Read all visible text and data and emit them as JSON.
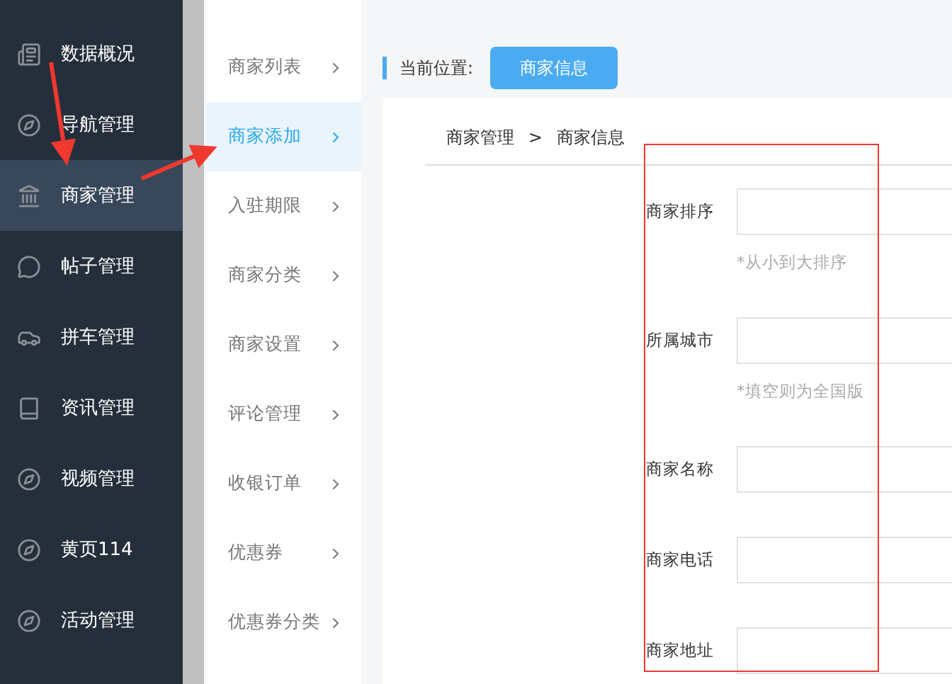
{
  "sidebar": {
    "items": [
      {
        "label": "数据概况",
        "selected": false
      },
      {
        "label": "导航管理",
        "selected": false
      },
      {
        "label": "商家管理",
        "selected": true
      },
      {
        "label": "帖子管理",
        "selected": false
      },
      {
        "label": "拼车管理",
        "selected": false
      },
      {
        "label": "资讯管理",
        "selected": false
      },
      {
        "label": "视频管理",
        "selected": false
      },
      {
        "label": "黄页114",
        "selected": false
      },
      {
        "label": "活动管理",
        "selected": false
      }
    ]
  },
  "submenu": {
    "items": [
      {
        "label": "商家列表",
        "selected": false
      },
      {
        "label": "商家添加",
        "selected": true
      },
      {
        "label": "入驻期限",
        "selected": false
      },
      {
        "label": "商家分类",
        "selected": false
      },
      {
        "label": "商家设置",
        "selected": false
      },
      {
        "label": "评论管理",
        "selected": false
      },
      {
        "label": "收银订单",
        "selected": false
      },
      {
        "label": "优惠券",
        "selected": false
      },
      {
        "label": "优惠券分类",
        "selected": false
      }
    ]
  },
  "location": {
    "label": "当前位置:",
    "button": "商家信息"
  },
  "breadcrumb": {
    "items": [
      "商家管理",
      "商家信息"
    ],
    "separator": ">"
  },
  "form": {
    "fields": [
      {
        "label": "商家排序",
        "hint": "*从小到大排序"
      },
      {
        "label": "所属城市",
        "hint": "*填空则为全国版"
      },
      {
        "label": "商家名称"
      },
      {
        "label": "商家电话"
      },
      {
        "label": "商家地址"
      }
    ]
  }
}
